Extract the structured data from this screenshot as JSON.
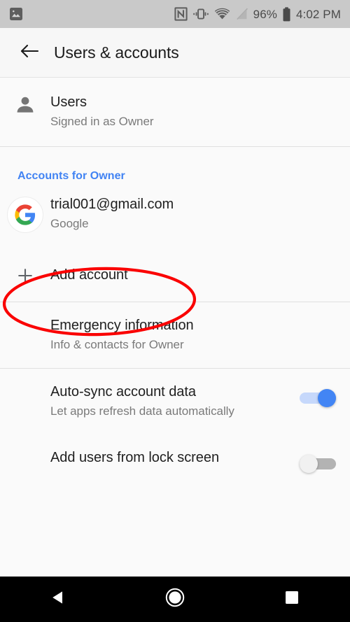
{
  "status_bar": {
    "notification_icon": "image-icon",
    "icons": [
      "nfc-icon",
      "vibrate-icon",
      "wifi-icon",
      "signal-off-icon"
    ],
    "battery_percent": "96%",
    "battery_icon": "battery-icon",
    "clock": "4:02 PM",
    "background_color": "#c9c9c9",
    "text_color": "#4a4a4a"
  },
  "action_bar": {
    "back_icon": "back-arrow-icon",
    "title": "Users & accounts"
  },
  "users_row": {
    "icon": "person-icon",
    "title": "Users",
    "subtitle": "Signed in as Owner"
  },
  "accounts_section": {
    "header": "Accounts for Owner",
    "header_color": "#4183f3",
    "account": {
      "icon": "google-logo-icon",
      "title": "trial001@gmail.com",
      "subtitle": "Google"
    },
    "add_account": {
      "icon": "plus-icon",
      "title": "Add account"
    }
  },
  "emergency_row": {
    "title": "Emergency information",
    "subtitle": "Info & contacts for Owner"
  },
  "auto_sync_row": {
    "title": "Auto-sync account data",
    "subtitle": "Let apps refresh data automatically",
    "toggle_state": "on",
    "toggle_color": "#4285f4"
  },
  "lock_screen_row": {
    "title": "Add users from lock screen",
    "toggle_state": "off",
    "toggle_color": "#b3b3b3"
  },
  "annotation": {
    "shape": "ellipse",
    "color": "#fa0000",
    "targets": "Add account"
  },
  "nav_bar": {
    "background_color": "#000000",
    "buttons": [
      "back-triangle-icon",
      "home-circle-icon",
      "recents-square-icon"
    ]
  }
}
